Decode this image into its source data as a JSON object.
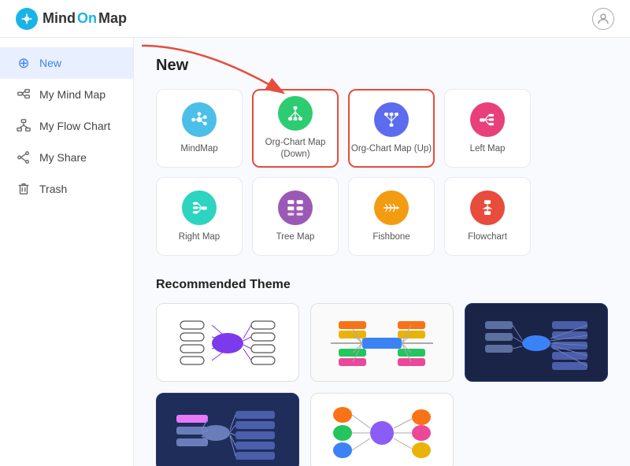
{
  "header": {
    "logo_text_mind": "Mind",
    "logo_text_on": "On",
    "logo_text_map": "Map"
  },
  "sidebar": {
    "items": [
      {
        "id": "new",
        "label": "New",
        "icon": "➕",
        "active": true
      },
      {
        "id": "my-mind-map",
        "label": "My Mind Map",
        "icon": "🗂"
      },
      {
        "id": "my-flow-chart",
        "label": "My Flow Chart",
        "icon": "📊"
      },
      {
        "id": "my-share",
        "label": "My Share",
        "icon": "🔗"
      },
      {
        "id": "trash",
        "label": "Trash",
        "icon": "🗑"
      }
    ]
  },
  "content": {
    "new_section_title": "New",
    "map_types": [
      {
        "id": "mindmap",
        "label": "MindMap",
        "color": "#4bbfe8",
        "symbol": "🌐"
      },
      {
        "id": "org-chart-down",
        "label": "Org-Chart Map\n(Down)",
        "color": "#2ecc71",
        "symbol": "⊕",
        "highlighted": true
      },
      {
        "id": "org-chart-up",
        "label": "Org-Chart Map (Up)",
        "color": "#5b6cee",
        "symbol": "⊕",
        "highlighted": true
      },
      {
        "id": "left-map",
        "label": "Left Map",
        "color": "#e8407a",
        "symbol": "⊞"
      },
      {
        "id": "right-map",
        "label": "Right Map",
        "color": "#2dd4bf",
        "symbol": "⊕"
      },
      {
        "id": "tree-map",
        "label": "Tree Map",
        "color": "#9b59b6",
        "symbol": "⊞"
      },
      {
        "id": "fishbone",
        "label": "Fishbone",
        "color": "#f39c12",
        "symbol": "✦"
      },
      {
        "id": "flowchart",
        "label": "Flowchart",
        "color": "#e74c3c",
        "symbol": "⊕"
      }
    ],
    "recommended_theme_title": "Recommended Theme",
    "themes": [
      {
        "id": "theme-1",
        "style": "light",
        "description": "Purple mind map theme"
      },
      {
        "id": "theme-2",
        "style": "mid",
        "description": "Colorful fishbone theme"
      },
      {
        "id": "theme-3",
        "style": "dark",
        "description": "Dark mind map theme"
      },
      {
        "id": "theme-4",
        "style": "dark2",
        "description": "Dark blue mind map"
      },
      {
        "id": "theme-5",
        "style": "light2",
        "description": "Colorful bubble theme"
      }
    ]
  }
}
